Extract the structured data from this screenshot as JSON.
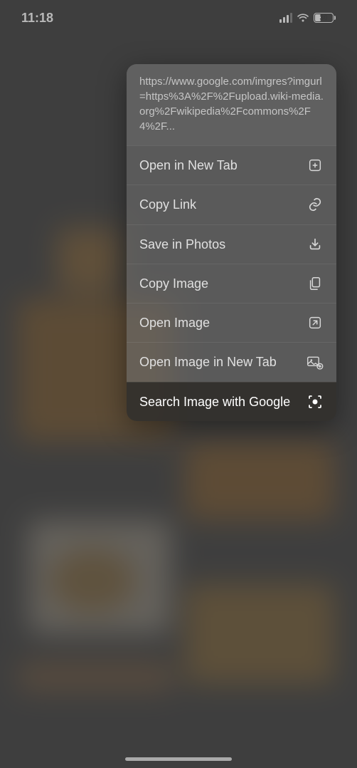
{
  "status_bar": {
    "time": "11:18",
    "battery_percent": "30"
  },
  "context_menu": {
    "url_preview": "https://www.google.com/imgres?imgurl=https%3A%2F%2Fupload.wiki-media.org%2Fwikipedia%2Fcommons%2F4%2F...",
    "items": [
      {
        "label": "Open in New Tab",
        "icon": "plus-square-icon"
      },
      {
        "label": "Copy Link",
        "icon": "link-icon"
      },
      {
        "label": "Save in Photos",
        "icon": "download-icon"
      },
      {
        "label": "Copy Image",
        "icon": "copy-doc-icon"
      },
      {
        "label": "Open Image",
        "icon": "open-external-icon"
      },
      {
        "label": "Open Image in New Tab",
        "icon": "image-plus-icon"
      },
      {
        "label": "Search Image with Google",
        "icon": "camera-search-icon",
        "highlighted": true
      }
    ]
  }
}
